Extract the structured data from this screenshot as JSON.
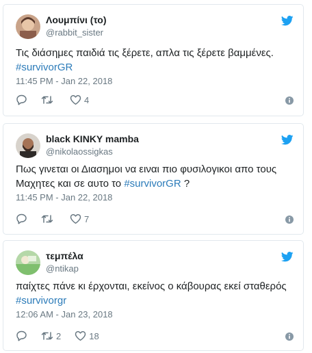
{
  "tweets": [
    {
      "name": "Λουμπίνι (το)",
      "handle": "@rabbit_sister",
      "text_plain": "Τις διάσημες παιδιά τις ξέρετε, απλα τις ξέρετε βαμμένες.",
      "hashtag": "#survivorGR",
      "text_after": "",
      "time": "11:45 PM - Jan 22, 2018",
      "retweets": "",
      "likes": "4"
    },
    {
      "name": "black KINKY mamba",
      "handle": "@nikolaossigkas",
      "text_plain": "Πως γινεται οι Διασημοι να ειναι πιο φυσιλογικοι απο τους Μαχητες και σε αυτο το",
      "hashtag": "#survivorGR",
      "text_after": " ?",
      "time": "11:45 PM - Jan 22, 2018",
      "retweets": "",
      "likes": "7"
    },
    {
      "name": "τεμπέλα",
      "handle": "@ntikap",
      "text_plain": "παίχτες πάνε κι έρχονται, εκείνος ο κάβουρας εκεί σταθερός",
      "hashtag": "#survivorgr",
      "text_after": "",
      "time": "12:06 AM - Jan 23, 2018",
      "retweets": "2",
      "likes": "18"
    }
  ],
  "icons": {
    "brand": "twitter-bird-icon",
    "reply": "reply-icon",
    "retweet": "retweet-icon",
    "like": "heart-icon",
    "info": "info-icon"
  },
  "colors": {
    "twitter_blue": "#1da1f2",
    "hashtag": "#2b7bb9",
    "meta_gray": "#697882",
    "border": "#e1e8ed"
  }
}
